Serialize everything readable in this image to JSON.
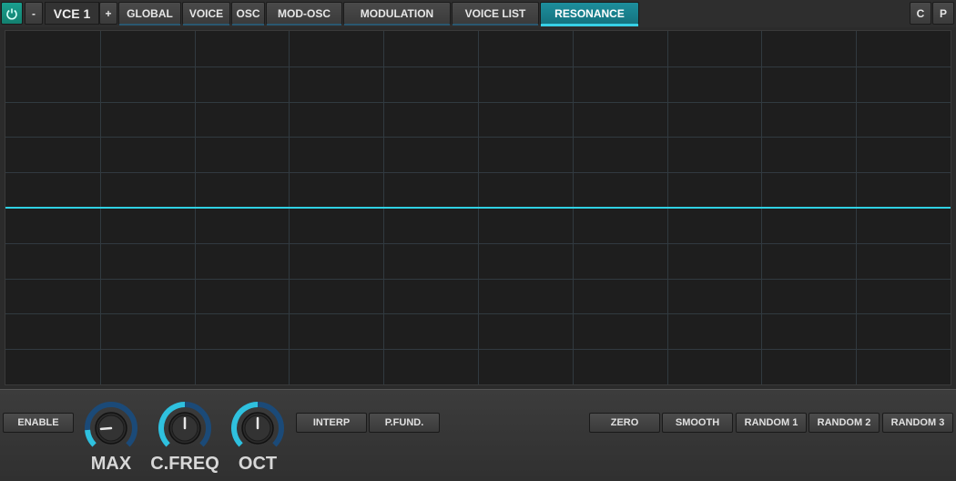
{
  "topbar": {
    "power_icon": "power-icon",
    "minus_label": "-",
    "voice_label": "VCE 1",
    "plus_label": "+",
    "tabs": [
      {
        "label": "GLOBAL"
      },
      {
        "label": "VOICE"
      },
      {
        "label": "OSC"
      },
      {
        "label": "MOD-OSC"
      },
      {
        "label": "MODULATION"
      },
      {
        "label": "VOICE LIST"
      },
      {
        "label": "RESONANCE"
      }
    ],
    "active_tab": "RESONANCE",
    "c_label": "C",
    "p_label": "P"
  },
  "graph": {
    "line_color": "#2fd0e3",
    "grid_color": "#313a40",
    "level": 0.5
  },
  "bottom": {
    "enable_label": "ENABLE",
    "knobs": [
      {
        "label": "MAX",
        "value": 0.15
      },
      {
        "label": "C.FREQ",
        "value": 0.5
      },
      {
        "label": "OCT",
        "value": 0.5
      }
    ],
    "interp_label": "INTERP",
    "pfund_label": "P.FUND.",
    "zero_label": "ZERO",
    "smooth_label": "SMOOTH",
    "random1_label": "RANDOM 1",
    "random2_label": "RANDOM 2",
    "random3_label": "RANDOM 3"
  },
  "colors": {
    "accent": "#2fc1de",
    "knob_track": "#1b4a78",
    "active_tab": "#178896"
  }
}
